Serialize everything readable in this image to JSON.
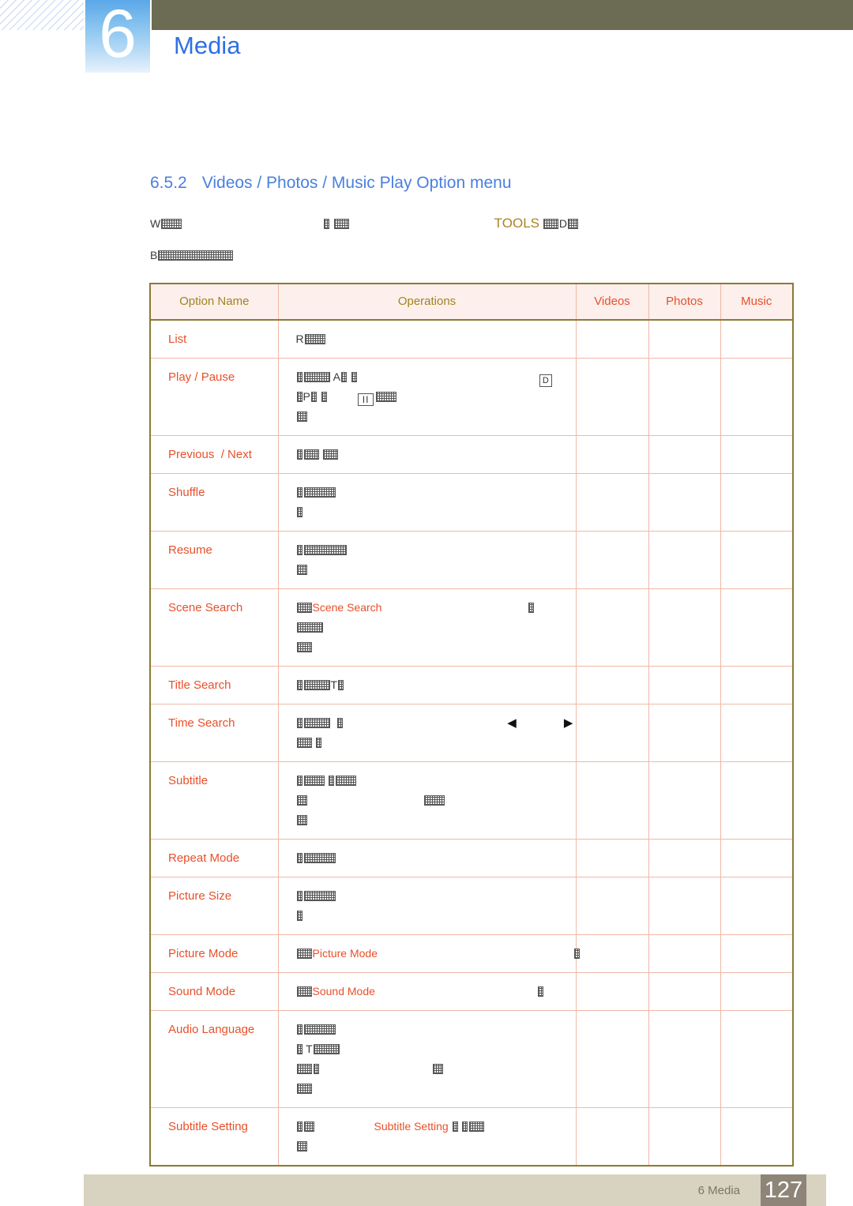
{
  "header": {
    "chapter_number": "6",
    "chapter_title": "Media"
  },
  "section": {
    "number": "6.5.2",
    "title": "Videos / Photos / Music Play Option menu"
  },
  "intro": {
    "line1_prefix": "W",
    "line1_tools": "TOOLS",
    "line2_prefix": "B"
  },
  "table": {
    "headers": [
      {
        "label": "Option Name",
        "style": "gold"
      },
      {
        "label": "Operations",
        "style": "gold"
      },
      {
        "label": "Videos",
        "style": "red"
      },
      {
        "label": "Photos",
        "style": "red"
      },
      {
        "label": "Music",
        "style": "red"
      }
    ],
    "rows": [
      {
        "option": "List",
        "option_parts": [
          "List"
        ],
        "lines": [
          {
            "frag": "R"
          }
        ]
      },
      {
        "option": "Play / Pause",
        "option_parts": [
          "Play",
          "/",
          "Pause"
        ],
        "lines": [
          {
            "frag": "A"
          },
          {
            "frag": "P"
          },
          {
            "frag": ""
          }
        ]
      },
      {
        "option": "Previous / Next",
        "option_parts": [
          "Previous",
          "/",
          "Next"
        ],
        "lines": [
          {
            "frag": ""
          }
        ]
      },
      {
        "option": "Shuffle",
        "option_parts": [
          "Shuffle"
        ],
        "lines": [
          {
            "frag": ""
          },
          {
            "frag": ""
          }
        ]
      },
      {
        "option": "Resume",
        "option_parts": [
          "Resume"
        ],
        "lines": [
          {
            "frag": ""
          },
          {
            "frag": ""
          }
        ]
      },
      {
        "option": "Scene Search",
        "option_parts": [
          "Scene Search"
        ],
        "inline_literal": "Scene Search",
        "lines": [
          {
            "frag": "Scene Search"
          },
          {
            "frag": ""
          },
          {
            "frag": ""
          }
        ]
      },
      {
        "option": "Title Search",
        "option_parts": [
          "Title Search"
        ],
        "lines": [
          {
            "frag": "T"
          }
        ]
      },
      {
        "option": "Time Search",
        "option_parts": [
          "Time Search"
        ],
        "lines": [
          {
            "frag": ""
          },
          {
            "frag": ""
          }
        ]
      },
      {
        "option": "Subtitle",
        "option_parts": [
          "Subtitle"
        ],
        "lines": [
          {
            "frag": ""
          },
          {
            "frag": ""
          },
          {
            "frag": ""
          }
        ]
      },
      {
        "option": "Repeat Mode",
        "option_parts": [
          "Repeat Mode"
        ],
        "lines": [
          {
            "frag": ""
          }
        ]
      },
      {
        "option": "Picture Size",
        "option_parts": [
          "Picture Size"
        ],
        "lines": [
          {
            "frag": ""
          },
          {
            "frag": ""
          }
        ]
      },
      {
        "option": "Picture Mode",
        "option_parts": [
          "Picture Mode"
        ],
        "inline_literal": "Picture Mode",
        "lines": [
          {
            "frag": "Picture Mode"
          }
        ]
      },
      {
        "option": "Sound Mode",
        "option_parts": [
          "Sound Mode"
        ],
        "inline_literal": "Sound Mode",
        "lines": [
          {
            "frag": "Sound Mode"
          }
        ]
      },
      {
        "option": "Audio Language",
        "option_parts": [
          "Audio Language"
        ],
        "lines": [
          {
            "frag": ""
          },
          {
            "frag": "T"
          },
          {
            "frag": ""
          },
          {
            "frag": ""
          }
        ]
      },
      {
        "option": "Subtitle Setting",
        "option_parts": [
          "Subtitle Setting"
        ],
        "inline_literal": "Subtitle Setting",
        "lines": [
          {
            "frag": "Subtitle Setting"
          },
          {
            "frag": ""
          }
        ]
      }
    ]
  },
  "cell_literals": {
    "scene_search": "Scene Search",
    "picture_mode": "Picture Mode",
    "sound_mode": "Sound Mode",
    "subtitle_setting": "Subtitle Setting"
  },
  "option_labels": {
    "list": "List",
    "play": "Play",
    "pause": "Pause",
    "previous": "Previous",
    "next": "Next",
    "shuffle": "Shuffle",
    "resume": "Resume",
    "scene_search": "Scene Search",
    "title_search": "Title Search",
    "time_search": "Time Search",
    "subtitle": "Subtitle",
    "repeat_mode": "Repeat Mode",
    "picture_size": "Picture Size",
    "picture_mode": "Picture Mode",
    "sound_mode": "Sound Mode",
    "audio_language": "Audio Language",
    "subtitle_setting": "Subtitle Setting",
    "slash": "/"
  },
  "icons": {
    "enter_key": "D",
    "pause_key": "II",
    "left_arrow": "◀",
    "right_arrow": "▶"
  },
  "footer": {
    "chapter_label": "6 Media",
    "page_number": "127"
  },
  "colors": {
    "header_band": "#6c6b54",
    "chapter_blue": "#2f6fe4",
    "section_blue": "#4a7fe0",
    "table_header_bg": "#fcefec",
    "gold": "#a08520",
    "red": "#e8502a",
    "border_outer": "#8a7b33",
    "border_inner": "#f0b9a6",
    "footer_bar": "#d8d2c0",
    "footer_page": "#8e8578"
  }
}
